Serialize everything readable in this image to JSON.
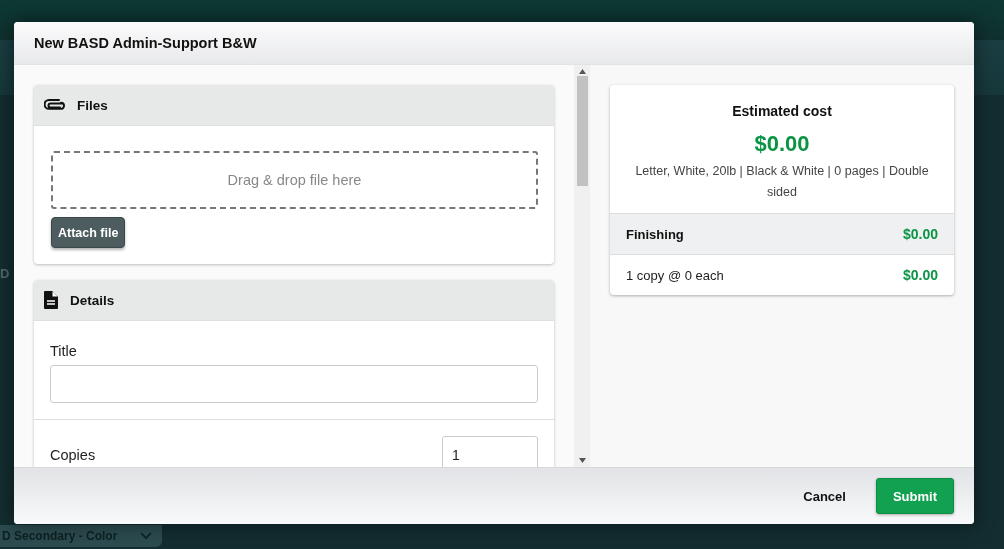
{
  "background": {
    "fragments": [
      "D"
    ],
    "dropdown": "D Secondary - Color"
  },
  "dialog": {
    "title": "New BASD Admin-Support B&W"
  },
  "files": {
    "heading": "Files",
    "dropzone": "Drag & drop file here",
    "attach_button": "Attach file"
  },
  "details": {
    "heading": "Details",
    "fields": [
      {
        "label": "Title"
      },
      {
        "label": "Copies",
        "value": "1"
      }
    ]
  },
  "estimate": {
    "heading": "Estimated cost",
    "total": "$0.00",
    "summary": "Letter, White, 20lb | Black & White | 0 pages | Double sided",
    "lines": [
      {
        "kind": "header",
        "label": "Finishing",
        "amount": "$0.00"
      },
      {
        "kind": "item",
        "label": "1 copy @ 0 each",
        "amount": "$0.00"
      }
    ]
  },
  "footer": {
    "buttons": [
      {
        "label": "Cancel",
        "kind": "secondary"
      },
      {
        "label": "Submit",
        "kind": "primary"
      }
    ]
  }
}
